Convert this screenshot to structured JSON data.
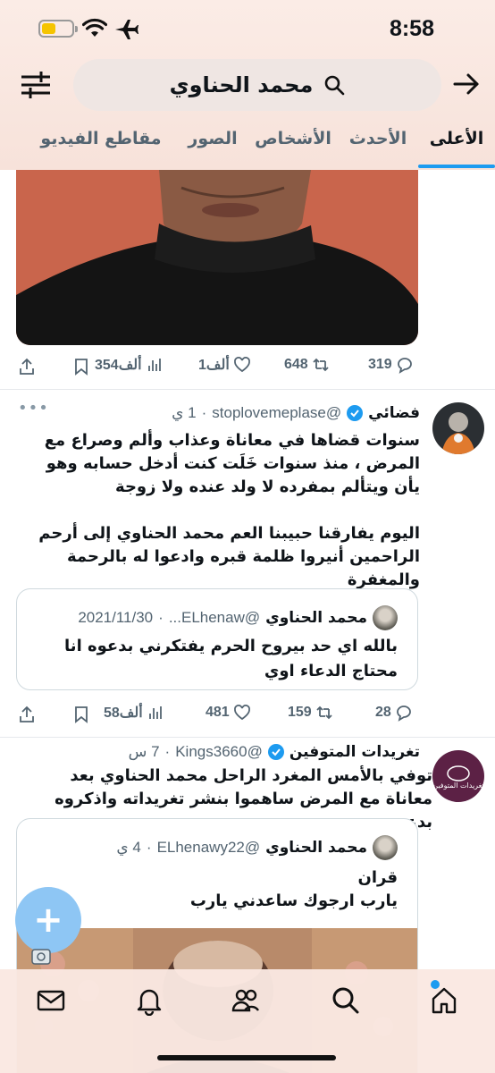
{
  "status_bar": {
    "time": "8:58"
  },
  "search": {
    "query": "محمد الحناوي"
  },
  "tabs": [
    {
      "label": "الأعلى",
      "active": true
    },
    {
      "label": "الأحدث",
      "active": false
    },
    {
      "label": "الأشخاص",
      "active": false
    },
    {
      "label": "الصور",
      "active": false
    },
    {
      "label": "مقاطع الفيديو",
      "active": false
    }
  ],
  "tweet0_actions": {
    "replies": "319",
    "retweets": "648",
    "likes": "1ألف",
    "views": "354ألف"
  },
  "tweet1": {
    "name": "فضائي",
    "handle": "@stoplovemeplase",
    "time": "1 ي",
    "body_p1": "سنوات قضاها في معاناة وعذاب وألم وصراع مع المرض ، منذ سنوات خَلَت كنت أدخل حسابه وهو يأن ويتألم بمفرده لا ولد عنده ولا زوجة",
    "body_p2": "اليوم يفارقنا حبيبنا العم محمد الحناوي إلى أرحم الراحمين أنيروا ظلمة قبره وادعوا له بالرحمة والمغفرة",
    "quote": {
      "name": "محمد الحناوي",
      "handle": "@ELhenaw...",
      "date": "2021/11/30",
      "body": "بالله اي حد بيروح الحرم يفتكرني بدعوه انا محتاج الدعاء اوي"
    },
    "actions": {
      "replies": "28",
      "retweets": "159",
      "likes": "481",
      "views": "58ألف"
    }
  },
  "tweet2": {
    "name": "تغريدات المتوفين",
    "handle": "@Kings3660",
    "time": "7 س",
    "avatar_text": "تغريدات المتوفين",
    "body": "توفي بالأمس المغرد الراحل محمد الحناوي بعد معاناة مع المرض ساهموا بنشر تغريداته واذكروه بدعوة .",
    "quote": {
      "name": "محمد الحناوي",
      "handle": "@ELhenawy22",
      "time": "4 ي",
      "line1": "قران",
      "line2": "يارب ارجوك ساعدني يارب"
    }
  },
  "fab": {
    "label": "+"
  },
  "colors": {
    "accent": "#1d9bf0",
    "chrome_bg": "#fbece6",
    "muted": "#536471"
  }
}
